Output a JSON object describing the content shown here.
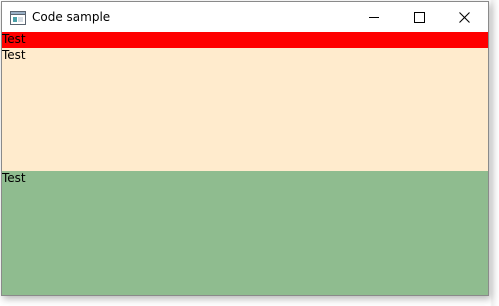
{
  "window": {
    "title": "Code sample"
  },
  "title_bar_icons": {
    "app": "app-window-icon",
    "minimize": "minimize-icon",
    "maximize": "maximize-icon",
    "close": "close-icon"
  },
  "rows": [
    {
      "text": "Test",
      "color": "#ff0000"
    },
    {
      "text": "Test",
      "color": "#ffebcd"
    },
    {
      "text": "Test",
      "color": "#8fbc8f"
    }
  ]
}
